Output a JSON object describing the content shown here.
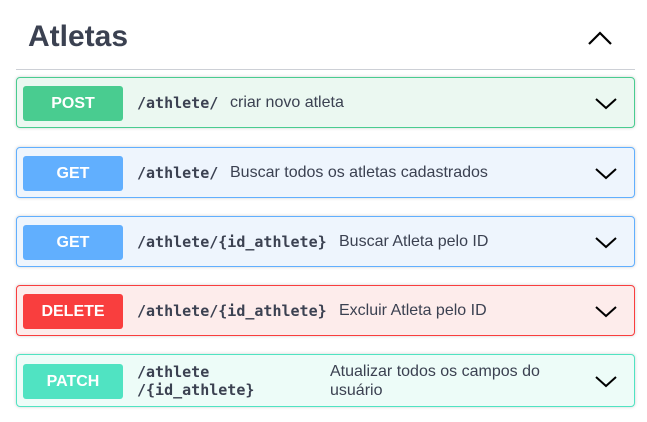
{
  "tag": {
    "title": "Atletas",
    "toggle_icon": "chevron-up-icon"
  },
  "operations": [
    {
      "method": "POST",
      "path": "/athlete/",
      "description": "criar novo atleta",
      "color": "#49cc90",
      "bg": "#ebf8f1",
      "border": "#49cc90"
    },
    {
      "method": "GET",
      "path": "/athlete/",
      "description": "Buscar todos os atletas cadastrados",
      "color": "#61affe",
      "bg": "#eef5fd",
      "border": "#61affe"
    },
    {
      "method": "GET",
      "path": "/athlete/{id_athlete}",
      "description": "Buscar Atleta pelo ID",
      "color": "#61affe",
      "bg": "#eef5fd",
      "border": "#61affe"
    },
    {
      "method": "DELETE",
      "path": "/athlete/{id_athlete}",
      "description": "Excluir Atleta pelo ID",
      "color": "#f93e3e",
      "bg": "#fdeceb",
      "border": "#f93e3e"
    },
    {
      "method": "PATCH",
      "path_line1": "/athlete",
      "path_line2": "/{id_athlete}",
      "description_line1": "Atualizar todos os campos do",
      "description_line2": "usuário",
      "color": "#50e3c2",
      "bg": "#edfcf8",
      "border": "#50e3c2"
    }
  ],
  "expand_icon": "chevron-down-icon"
}
